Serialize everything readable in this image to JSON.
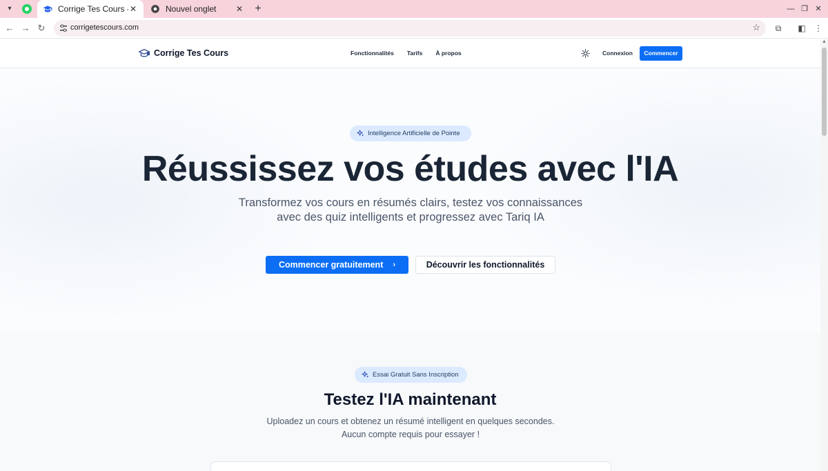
{
  "browser": {
    "tabs": [
      {
        "title": "Corrige Tes Cours - Plate",
        "active": true
      },
      {
        "title": "Nouvel onglet",
        "active": false
      }
    ],
    "url": "corrigetescours.com"
  },
  "header": {
    "brand": "Corrige Tes Cours",
    "nav": [
      "Fonctionnalités",
      "Tarifs",
      "À propos"
    ],
    "login": "Connexion",
    "start": "Commencer"
  },
  "hero": {
    "badge": "Intelligence Artificielle de Pointe",
    "title": "Réussissez vos études avec l'IA",
    "subtitle": "Transformez vos cours en résumés clairs, testez vos connaissances avec des quiz intelligents et progressez avec Tariq IA",
    "cta_primary": "Commencer gratuitement",
    "cta_secondary": "Découvrir les fonctionnalités"
  },
  "trial": {
    "badge": "Essai Gratuit Sans Inscription",
    "title": "Testez l'IA maintenant",
    "description_line1": "Uploadez un cours et obtenez un résumé intelligent en quelques secondes.",
    "description_line2": "Aucun compte requis pour essayer !"
  },
  "colors": {
    "primary": "#0b6ef5",
    "badge_bg": "#dbeafe",
    "heading": "#1a2535",
    "tab_strip": "#f7d3dc"
  },
  "icons": {
    "brand": "graduation-cap-icon",
    "theme_toggle": "sun-icon",
    "badge": "sparkles-icon",
    "cta_arrow": "chevron-right-icon"
  }
}
